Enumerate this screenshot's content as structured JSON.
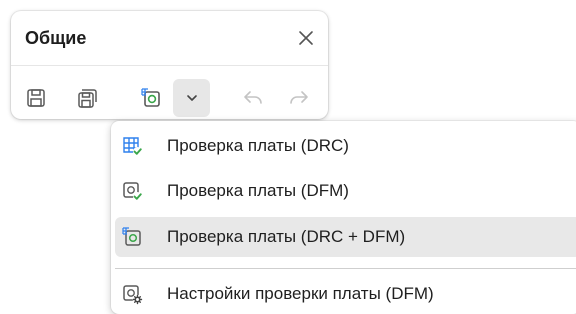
{
  "panel": {
    "title": "Общие",
    "close_icon": "close-icon",
    "tools": [
      {
        "name": "save-icon",
        "label": ""
      },
      {
        "name": "save-all-icon",
        "label": ""
      },
      {
        "name": "board-check-icon",
        "label": ""
      },
      {
        "name": "chevron-down-icon",
        "label": ""
      },
      {
        "name": "undo-icon",
        "label": ""
      },
      {
        "name": "redo-icon",
        "label": ""
      }
    ]
  },
  "menu": {
    "items": [
      {
        "label": "Проверка платы (DRC)",
        "icon": "drc-check-icon"
      },
      {
        "label": "Проверка платы (DFM)",
        "icon": "dfm-check-icon"
      },
      {
        "label": "Проверка платы (DRC + DFM)",
        "icon": "drc-dfm-check-icon",
        "selected": true
      },
      {
        "label": "Настройки проверки платы (DFM)",
        "icon": "dfm-settings-icon"
      }
    ]
  },
  "colors": {
    "accent_blue": "#2f80ed",
    "accent_green": "#3aa64a",
    "icon_gray": "#5a5a5a",
    "selected_bg": "#e8e8e8"
  }
}
